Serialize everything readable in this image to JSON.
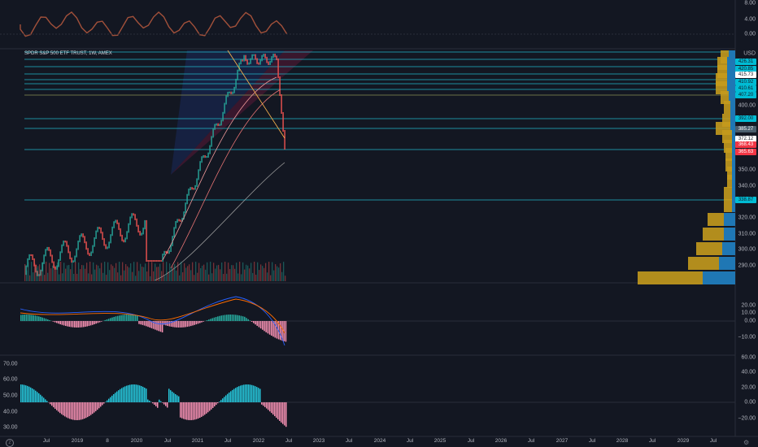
{
  "chart": {
    "symbol_label": "SPDR S&P 500 ETF TRUST, 1W, AMEX",
    "currency": "USD",
    "zoom_button_label": "Z",
    "settings_icon": "gear-icon",
    "time_axis": [
      "Jul",
      "2019",
      "8",
      "2020",
      "Jul",
      "2021",
      "Jul",
      "2022",
      "Jul",
      "2023",
      "Jul",
      "2024",
      "Jul",
      "2025",
      "Jul",
      "2026",
      "Jul",
      "2027",
      "Jul",
      "2028",
      "Jul",
      "2029",
      "Jul"
    ],
    "price_axis": [
      "400.00",
      "350.00",
      "340.00",
      "330.00",
      "320.00",
      "310.00",
      "300.00",
      "290.00"
    ],
    "top_osc_axis": [
      "8.00",
      "4.00",
      "0.00"
    ],
    "macd_axis": [
      "20.00",
      "10.00",
      "0.00",
      "−10.00"
    ],
    "rsi_axis": [
      "60.00",
      "40.00",
      "20.00",
      "0.00",
      "−20.00"
    ],
    "rsi_left_axis": [
      "70.00",
      "60.00",
      "50.00",
      "40.00",
      "30.00"
    ],
    "price_tags": [
      {
        "text": "426.31",
        "color": "#00bcd4",
        "text_color": "#131722"
      },
      {
        "text": "420.85",
        "color": "#00bcd4",
        "text_color": "#131722"
      },
      {
        "text": "415.73",
        "color": "#ffffff",
        "text_color": "#131722"
      },
      {
        "text": "410.92",
        "color": "#00bcd4",
        "text_color": "#131722"
      },
      {
        "text": "410.61",
        "color": "#00bcd4",
        "text_color": "#131722"
      },
      {
        "text": "407.20",
        "color": "#00bcd4",
        "text_color": "#131722"
      },
      {
        "text": "392.00",
        "color": "#00bcd4",
        "text_color": "#131722"
      },
      {
        "text": "385.27",
        "color": "#4a5e6d",
        "text_color": "#ffffff"
      },
      {
        "text": "372.12",
        "color": "#ffffff",
        "text_color": "#131722"
      },
      {
        "text": "368.43",
        "color": "#f23645",
        "text_color": "#ffffff"
      },
      {
        "text": "365.63",
        "color": "#f23645",
        "text_color": "#ffffff"
      },
      {
        "text": "338.87",
        "color": "#00bcd4",
        "text_color": "#131722"
      }
    ],
    "colors": {
      "background": "#131722",
      "up": "#26a69a",
      "down": "#ef5350",
      "level_line": "#22b7c8",
      "vp_gold": "#c49a1d",
      "vp_blue": "#1f77b4"
    }
  },
  "chart_data": [
    {
      "type": "line",
      "title": "",
      "series": [
        {
          "name": "",
          "values": [
            3,
            2,
            5,
            1,
            6,
            2,
            4,
            5,
            3,
            6,
            2,
            3,
            4,
            1,
            3,
            5,
            4,
            2
          ]
        }
      ],
      "ylim": [
        -2,
        8
      ]
    },
    {
      "type": "bar",
      "title": "SPDR S&P 500 ETF TRUST, 1W, AMEX",
      "categories": [
        "2019",
        "2020",
        "2021",
        "2022"
      ],
      "values": [
        290,
        330,
        440,
        385
      ],
      "ylabel": "USD",
      "ylim": [
        285,
        440
      ]
    },
    {
      "type": "bar",
      "title": "",
      "categories": [
        "2019",
        "2020",
        "2021",
        "2022"
      ],
      "values": [
        4,
        -12,
        14,
        -22
      ],
      "ylim": [
        -20,
        25
      ]
    },
    {
      "type": "bar",
      "title": "",
      "categories": [
        "2019",
        "2020",
        "2021",
        "2022"
      ],
      "values": [
        8,
        -15,
        40,
        -25
      ],
      "ylim": [
        -25,
        65
      ]
    }
  ]
}
